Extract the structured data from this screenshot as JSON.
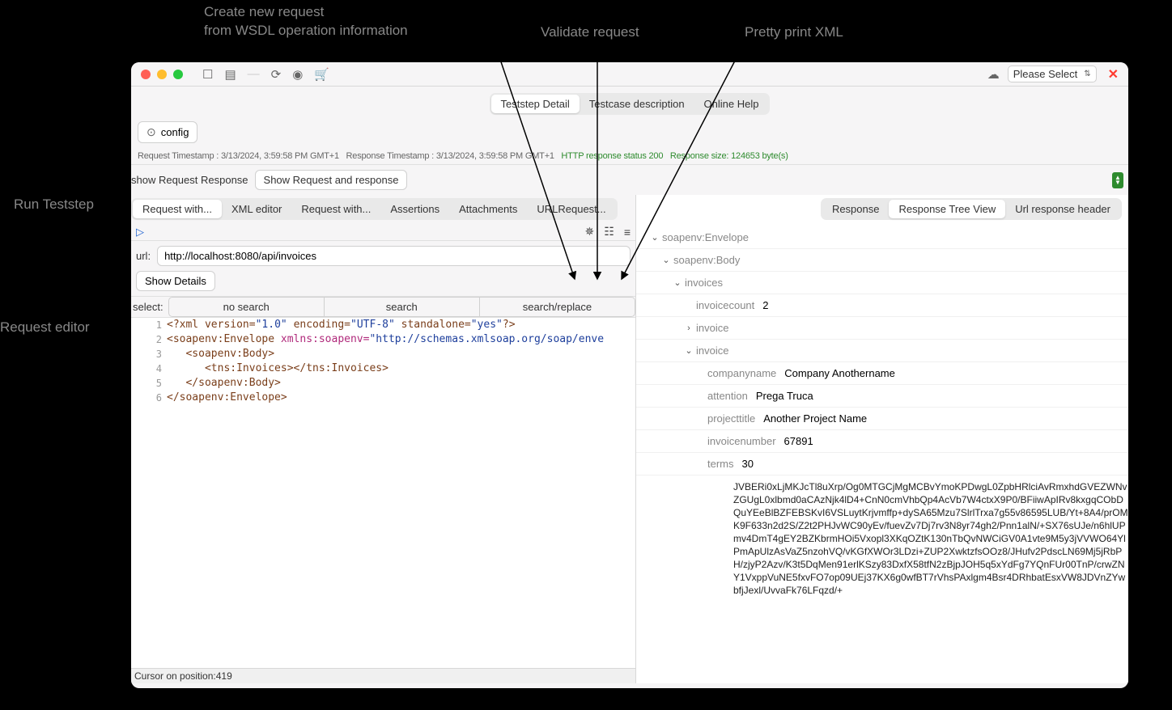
{
  "annotations": {
    "create_request": "Create new request",
    "from_wsdl": "from WSDL operation information",
    "validate_request": "Validate request",
    "pretty_print": "Pretty print XML",
    "run_teststep": "Run Teststep",
    "request_editor": "Request editor"
  },
  "titlebar": {
    "please_select": "Please Select"
  },
  "top_tabs": {
    "detail": "Teststep Detail",
    "description": "Testcase description",
    "help": "Online Help"
  },
  "config_button": "config",
  "status": {
    "req_ts_label": "Request Timestamp :",
    "req_ts_value": "3/13/2024, 3:59:58 PM GMT+1",
    "resp_ts_label": "Response Timestamp :",
    "resp_ts_value": "3/13/2024, 3:59:58 PM GMT+1",
    "http_status": "HTTP response status 200",
    "resp_size": "Response size: 124653  byte(s)"
  },
  "show_row": {
    "label": "show Request Response",
    "value": "Show Request and response"
  },
  "left_tabs": {
    "request_with": "Request with...",
    "xml_editor": "XML editor",
    "request_with2": "Request with...",
    "assertions": "Assertions",
    "attachments": "Attachments",
    "url_request": "URLRequest..."
  },
  "right_tabs": {
    "response": "Response",
    "response_tree": "Response Tree View",
    "url_response_header": "Url response header"
  },
  "url_row": {
    "label": "url:",
    "value": "http://localhost:8080/api/invoices"
  },
  "show_details": "Show Details",
  "search_row": {
    "label": "select:",
    "no_search": "no search",
    "search": "search",
    "search_replace": "search/replace"
  },
  "editor_lines": [
    {
      "n": "1",
      "html": "<span class='xml-tag'>&lt;?xml</span> <span class='xml-attr'>version=</span><span class='xml-val'>\"1.0\"</span> <span class='xml-attr'>encoding=</span><span class='xml-val'>\"UTF-8\"</span> <span class='xml-attr'>standalone=</span><span class='xml-val'>\"yes\"</span><span class='xml-tag'>?&gt;</span>"
    },
    {
      "n": "2",
      "html": "<span class='xml-tag'>&lt;soapenv:Envelope</span> <span class='xml-ns'>xmlns:soapenv=</span><span class='xml-val'>\"http://schemas.xmlsoap.org/soap/enve</span>"
    },
    {
      "n": "3",
      "html": "   <span class='xml-tag'>&lt;soapenv:Body&gt;</span>"
    },
    {
      "n": "4",
      "html": "      <span class='xml-tag'>&lt;tns:Invoices&gt;&lt;/tns:Invoices&gt;</span>"
    },
    {
      "n": "5",
      "html": "   <span class='xml-tag'>&lt;/soapenv:Body&gt;</span>"
    },
    {
      "n": "6",
      "html": "<span class='xml-tag'>&lt;/soapenv:Envelope&gt;</span>"
    }
  ],
  "cursor_status": "Cursor on position:419",
  "tree": {
    "envelope": "soapenv:Envelope",
    "body": "soapenv:Body",
    "invoices": "invoices",
    "invoicecount_key": "invoicecount",
    "invoicecount_val": "2",
    "invoice_collapsed": "invoice",
    "invoice_expanded": "invoice",
    "companyname_key": "companyname",
    "companyname_val": "Company Anothername",
    "attention_key": "attention",
    "attention_val": "Prega Truca",
    "projecttitle_key": "projecttitle",
    "projecttitle_val": "Another Project Name",
    "invoicenumber_key": "invoicenumber",
    "invoicenumber_val": "67891",
    "terms_key": "terms",
    "terms_val": "30",
    "blob": "JVBERi0xLjMKJcTl8uXrp/Og0MTGCjMgMCBvYmoKPDwgL0ZpbHRlciAvRmxhdGVEZWNvZGUgL0xlbmd0aCAzNjk4lD4+CnN0cmVhbQp4AcVb7W4ctxX9P0/BFiiwApIRv8kxgqCObDQuYEeBlBZFEBSKvI6VSLuytKrjvmffp+dySA65Mzu7SlrlTrxa7g55v86595LUB/Yt+8A4/prOMK9F633n2d2S/Z2t2PHJvWC90yEv/fuevZv7Dj7rv3N8yr74gh2/Pnn1alN/+SX76sUJe/n6hlUPmv4DmT4gEY2BZKbrmHOi5Vxopl3XKqOZtK130nTbQvNWCiGV0A1vte9M5y3jVVWO64YlPmApUlzAsVaZ5nzohVQ/vKGfXWOr3LDzi+ZUP2XwktzfsOOz8/JHufv2PdscLN69Mj5jRbPH/zjyP2Azv/K3t5DqMen91erlKSzy83DxfX58tfN2zBjpJOH5q5xYdFg7YQnFUr00TnP/crwZNY1VxppVuNE5fxvFO7op09UEj37KX6g0wfBT7rVhsPAxlgm4Bsr4DRhbatEsxVW8JDVnZYwbfjJexl/UvvaFk76LFqzd/+"
  }
}
